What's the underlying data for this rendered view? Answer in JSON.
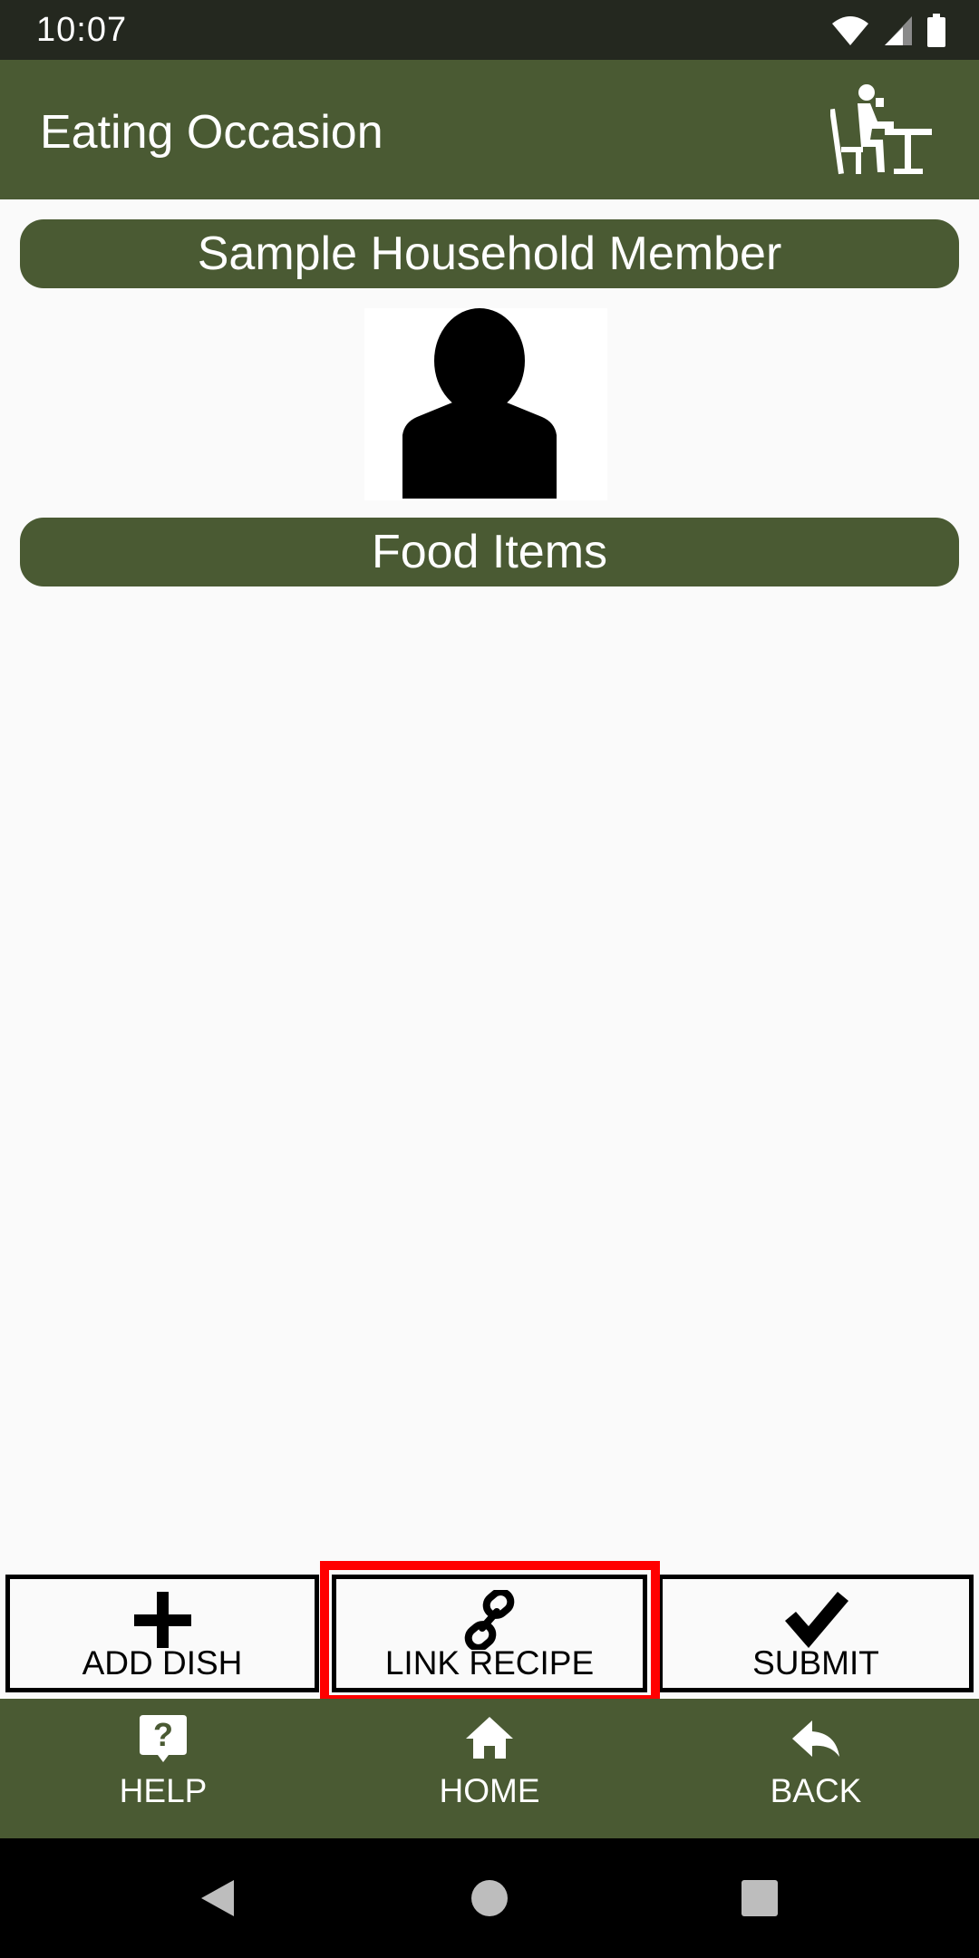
{
  "status_bar": {
    "time": "10:07",
    "icons": [
      "wifi-icon",
      "cell-signal-icon",
      "battery-icon"
    ]
  },
  "app_bar": {
    "title": "Eating Occasion",
    "icon": "dining-person-icon"
  },
  "member": {
    "name": "Sample Household Member",
    "avatar_icon": "person-silhouette-icon"
  },
  "food_section": {
    "title": "Food Items",
    "items": []
  },
  "actions": {
    "add_dish": "ADD DISH",
    "link_recipe": "LINK RECIPE",
    "submit": "SUBMIT"
  },
  "bottom_nav": {
    "help": "HELP",
    "home": "HOME",
    "back": "BACK"
  },
  "colors": {
    "primary": "#4a5a33",
    "status_bar": "#24281f",
    "highlight": "#ff0000",
    "background": "#fafafa"
  }
}
